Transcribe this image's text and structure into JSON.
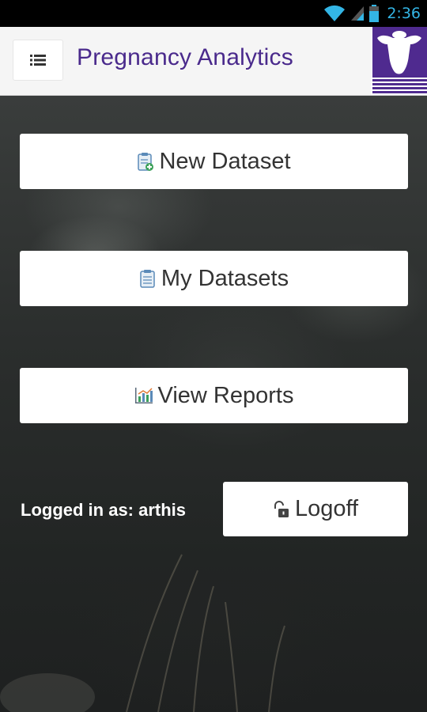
{
  "status_bar": {
    "time": "2:36",
    "icons": [
      "wifi-icon",
      "signal-icon",
      "battery-icon"
    ],
    "accent_color": "#33b5e5"
  },
  "header": {
    "menu_icon": "list-menu-icon",
    "title": "Pregnancy Analytics",
    "title_color": "#4a2a8c",
    "logo_icon": "cow-head-logo"
  },
  "main": {
    "new_dataset": {
      "label": "New Dataset",
      "icon": "clipboard-add-icon"
    },
    "my_datasets": {
      "label": "My Datasets",
      "icon": "clipboard-list-icon"
    },
    "view_reports": {
      "label": "View Reports",
      "icon": "bar-chart-icon"
    },
    "logged_in_label": "Logged in as: arthis",
    "logoff": {
      "label": "Logoff",
      "icon": "unlock-icon"
    }
  }
}
